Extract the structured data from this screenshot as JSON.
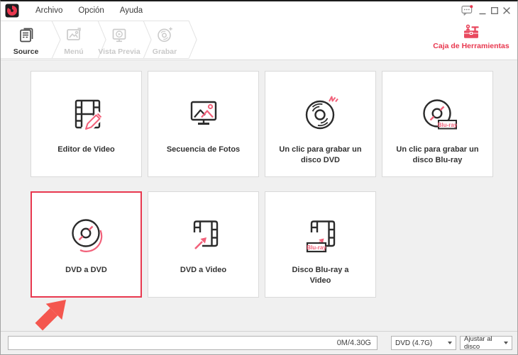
{
  "colors": {
    "accent_red": "#e8384f",
    "icon_pink": "#f2617a",
    "icon_dark": "#2b2b2b",
    "arrow_red": "#f4574f",
    "inactive_grey": "#c9c9c9",
    "main_bg": "#f0f0f0"
  },
  "titlebar": {
    "menu_items": [
      {
        "label": "Archivo"
      },
      {
        "label": "Opción"
      },
      {
        "label": "Ayuda"
      }
    ]
  },
  "steps": [
    {
      "label": "Source",
      "state": "active"
    },
    {
      "label": "Menú",
      "state": "inactive"
    },
    {
      "label": "Vista Previa",
      "state": "inactive"
    },
    {
      "label": "Grabar",
      "state": "inactive"
    }
  ],
  "toolbox": {
    "label": "Caja de Herramientas"
  },
  "cards": [
    {
      "label": "Editor de Video"
    },
    {
      "label": "Secuencia de Fotos"
    },
    {
      "label": "Un clic para grabar un disco DVD"
    },
    {
      "label": "Un clic para grabar un disco Blu-ray",
      "badge": "Blu-ray"
    },
    {
      "label": "DVD a DVD",
      "selected": true
    },
    {
      "label": "DVD a Video"
    },
    {
      "label": "Disco Blu-ray a Video",
      "badge": "Blu-ray"
    }
  ],
  "statusbar": {
    "capacity": "0M/4.30G",
    "disc_type": "DVD (4.7G)",
    "fit_mode": "Ajustar al disco"
  }
}
